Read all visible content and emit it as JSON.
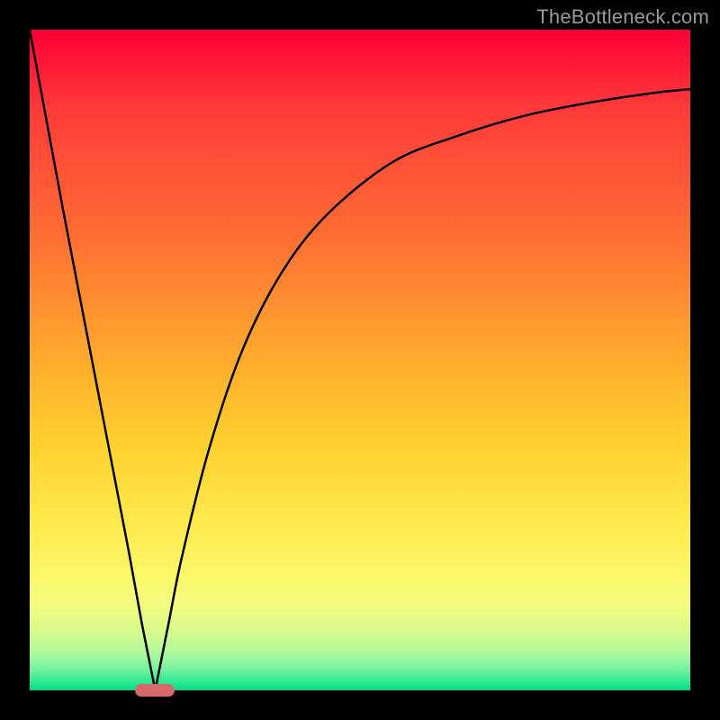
{
  "watermark": {
    "text": "TheBottleneck.com"
  },
  "chart_data": {
    "type": "line",
    "title": "",
    "xlabel": "",
    "ylabel": "",
    "xlim": [
      0,
      100
    ],
    "ylim": [
      0,
      100
    ],
    "grid": false,
    "legend": false,
    "marker": {
      "x": 19,
      "y": 0,
      "color": "#d66a6a"
    },
    "gradient_stops": [
      {
        "pos": 0,
        "color": "#ff0033"
      },
      {
        "pos": 30,
        "color": "#ff6a33"
      },
      {
        "pos": 62,
        "color": "#ffcf2e"
      },
      {
        "pos": 87,
        "color": "#f3fb7e"
      },
      {
        "pos": 100,
        "color": "#00df82"
      }
    ],
    "series": [
      {
        "name": "curve",
        "x": [
          0,
          5,
          10,
          15,
          17,
          19,
          21,
          23,
          27,
          32,
          38,
          45,
          55,
          65,
          75,
          85,
          95,
          100
        ],
        "values": [
          100,
          73,
          47,
          21,
          10,
          0,
          10,
          20,
          36,
          51,
          63,
          72,
          80,
          84,
          87,
          89,
          90.5,
          91
        ]
      }
    ]
  }
}
